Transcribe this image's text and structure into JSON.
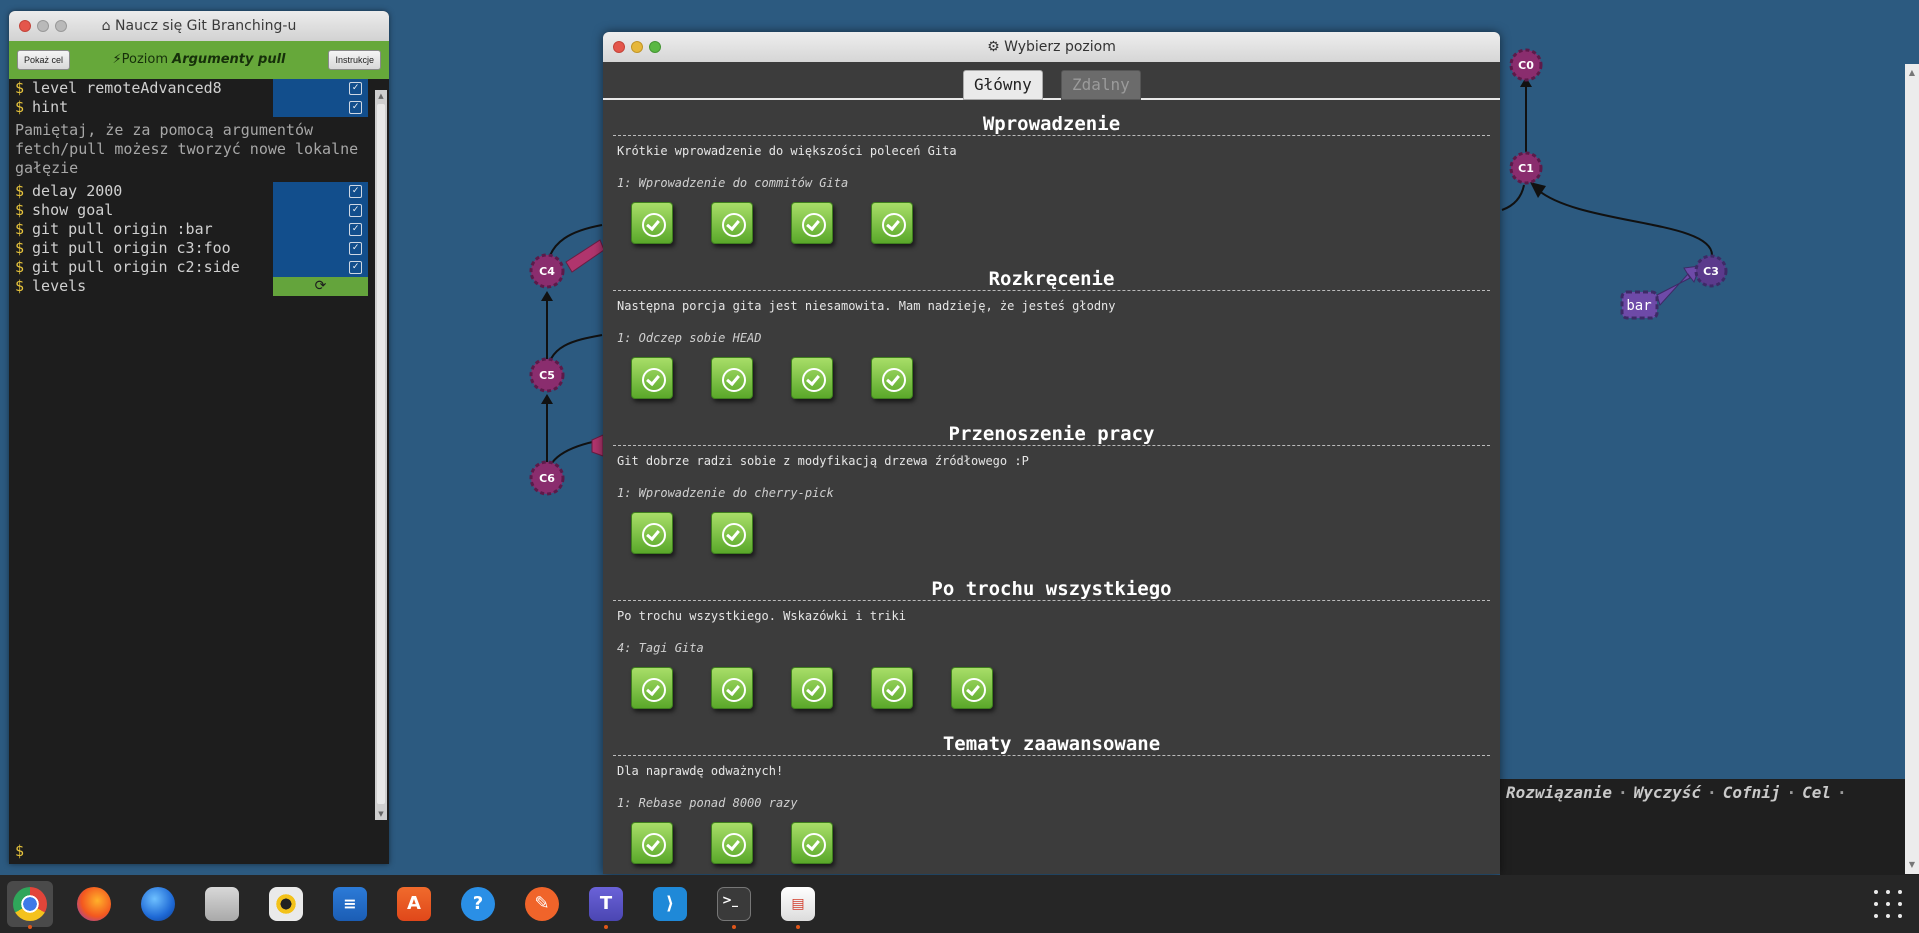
{
  "canvas": {
    "nodes": [
      "C0",
      "C1",
      "C3",
      "C4",
      "C5",
      "C6"
    ],
    "branch_label": "bar",
    "bottom_links": [
      "Rozwiązanie",
      "Wyczyść",
      "Cofnij",
      "Cel"
    ],
    "colors": {
      "background": "#2c5a80",
      "node_magenta": "#8a2d6e",
      "node_purple": "#5b3a8c",
      "arrow_magenta": "#b0356d",
      "arrow_purple": "#6e4aa8"
    }
  },
  "cmd_panel": {
    "title": "Naucz się Git Branching-u",
    "title_icon": "home-icon",
    "show_goal_label": "Pokaż cel",
    "level_prefix": "Poziom",
    "level_name": "Argumenty pull",
    "instructions_label": "Instrukcje",
    "commands": [
      {
        "text": "level remoteAdvanced8",
        "status": "done"
      },
      {
        "text": "hint",
        "status": "done"
      }
    ],
    "hint_text": "Pamiętaj, że za pomocą argumentów fetch/pull możesz tworzyć nowe lokalne gałęzie",
    "commands2": [
      {
        "text": "delay 2000",
        "status": "done"
      },
      {
        "text": "show goal",
        "status": "done"
      },
      {
        "text": "git pull origin :bar",
        "status": "done"
      },
      {
        "text": "git pull origin c3:foo",
        "status": "done"
      },
      {
        "text": "git pull origin c2:side",
        "status": "done"
      },
      {
        "text": "levels",
        "status": "processing"
      }
    ],
    "prompt": "$"
  },
  "dialog": {
    "title": "Wybierz poziom",
    "title_icon": "gear-icon",
    "tabs": [
      {
        "label": "Główny",
        "active": true
      },
      {
        "label": "Zdalny",
        "active": false
      }
    ],
    "sequences": [
      {
        "title": "Wprowadzenie",
        "description": "Krótkie wprowadzenie do większości poleceń Gita",
        "current_level": "1: Wprowadzenie do commitów Gita",
        "levels": 4
      },
      {
        "title": "Rozkręcenie",
        "description": "Następna porcja gita jest niesamowita. Mam nadzieję, że jesteś głodny",
        "current_level": "1: Odczep sobie HEAD",
        "levels": 4
      },
      {
        "title": "Przenoszenie pracy",
        "description": "Git dobrze radzi sobie z modyfikacją drzewa źródłowego :P",
        "current_level": "1: Wprowadzenie do cherry-pick",
        "levels": 2
      },
      {
        "title": "Po trochu wszystkiego",
        "description": "Po trochu wszystkiego. Wskazówki i triki",
        "current_level": "4: Tagi Gita",
        "levels": 5
      },
      {
        "title": "Tematy zaawansowane",
        "description": "Dla naprawdę odważnych!",
        "current_level": "1: Rebase ponad 8000 razy",
        "levels": 3
      }
    ]
  },
  "taskbar": {
    "apps": [
      {
        "name": "chrome-icon",
        "active": true,
        "indicator": true
      },
      {
        "name": "firefox-icon",
        "active": false,
        "indicator": false
      },
      {
        "name": "thunderbird-icon",
        "active": false,
        "indicator": false
      },
      {
        "name": "files-icon",
        "active": false,
        "indicator": false
      },
      {
        "name": "rhythmbox-icon",
        "active": false,
        "indicator": false
      },
      {
        "name": "writer-icon",
        "active": false,
        "indicator": false
      },
      {
        "name": "app-store-icon",
        "active": false,
        "indicator": false
      },
      {
        "name": "help-icon",
        "active": false,
        "indicator": false
      },
      {
        "name": "inkscape-icon",
        "active": false,
        "indicator": false
      },
      {
        "name": "teams-icon",
        "active": false,
        "indicator": true
      },
      {
        "name": "vscode-icon",
        "active": false,
        "indicator": false
      },
      {
        "name": "terminal-icon",
        "active": false,
        "indicator": true
      },
      {
        "name": "document-viewer-icon",
        "active": false,
        "indicator": true
      }
    ],
    "show_apps": "apps-grid-icon"
  }
}
